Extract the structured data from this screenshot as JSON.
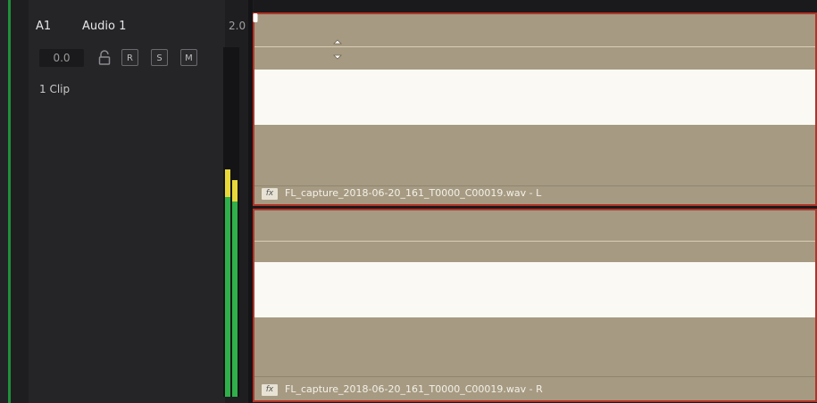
{
  "track": {
    "id": "A1",
    "name": "Audio 1",
    "format": "2.0",
    "volume": "0.0",
    "buttons": [
      "R",
      "S",
      "M"
    ],
    "clip_count": "1 Clip"
  },
  "meters": {
    "left_level": 0.65,
    "right_level": 0.62,
    "left_peak_yellow": 0.08,
    "right_peak_yellow": 0.06
  },
  "clips": [
    {
      "name": "FL_capture_2018-06-20_161_T0000_C00019.wav - L",
      "fx": "fx"
    },
    {
      "name": "FL_capture_2018-06-20_161_T0000_C00019.wav - R",
      "fx": "fx"
    }
  ],
  "colors": {
    "clip_fill": "#a69a82",
    "clip_border": "#b23427",
    "waveform": "#faf9f4",
    "meter_green": "#2fb04a",
    "meter_yellow": "#e8d83a",
    "track_edge": "#1f8f3a"
  },
  "icons": {
    "lock": "lock-icon",
    "fx": "fx-icon",
    "playhead": "playhead-icon",
    "nudge_up": "chevron-up-icon",
    "nudge_down": "chevron-down-icon"
  }
}
